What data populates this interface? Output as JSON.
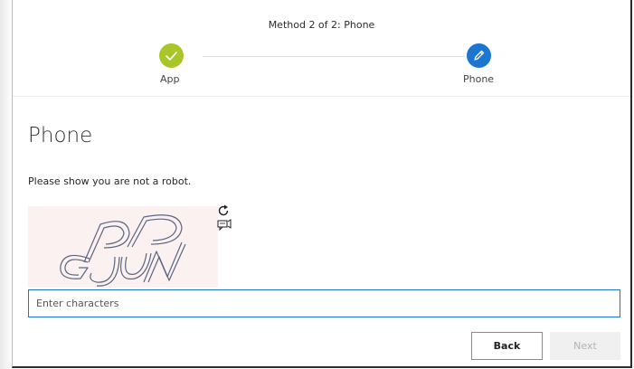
{
  "header": {
    "title": "Method 2 of 2: Phone"
  },
  "steps": [
    {
      "label": "App",
      "state": "completed",
      "icon": "checkmark-icon",
      "color": "#a8c62a"
    },
    {
      "label": "Phone",
      "state": "current",
      "icon": "pencil-icon",
      "color": "#1b76d2"
    }
  ],
  "main": {
    "heading": "Phone",
    "instruction": "Please show you are not a robot.",
    "captcha": {
      "text": "PPGJN",
      "refresh_icon": "refresh-icon",
      "audio_icon": "audio-challenge-icon"
    },
    "input": {
      "placeholder": "Enter characters",
      "value": ""
    }
  },
  "buttons": {
    "back_label": "Back",
    "next_label": "Next"
  },
  "colors": {
    "accent": "#1b76d2",
    "success": "#a8c62a"
  }
}
